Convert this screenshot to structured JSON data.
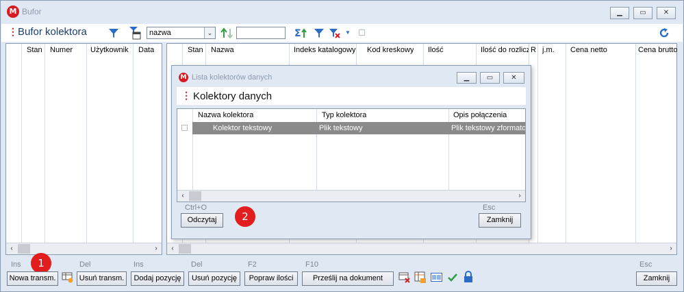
{
  "window": {
    "title": "Bufor",
    "logo": "M"
  },
  "toolbar": {
    "title": "Bufor kolektora",
    "sort_field": "nazwa",
    "search_value": ""
  },
  "left_grid": {
    "columns": [
      "Stan",
      "Numer",
      "Użytkownik",
      "Data"
    ]
  },
  "right_grid": {
    "columns": [
      "Stan",
      "Nazwa",
      "Indeks katalogowy",
      "Kod kreskowy",
      "Ilość",
      "Ilość do rozlicz",
      "R",
      "j.m.",
      "Cena netto",
      "Cena brutto"
    ]
  },
  "dialog": {
    "title": "Lista kolektorów danych",
    "logo": "M",
    "header_title": "Kolektory danych",
    "columns": [
      "Nazwa kolektora",
      "Typ kolektora",
      "Opis połączenia"
    ],
    "rows": [
      {
        "name": "Kolektor tekstowy",
        "type": "Plik tekstowy",
        "description": "Plik tekstowy zformatow"
      }
    ],
    "read_key": "Ctrl+O",
    "read_label": "Odczytaj",
    "close_key": "Esc",
    "close_label": "Zamknij",
    "badge": "2"
  },
  "status": {
    "badge": "1",
    "buttons": [
      {
        "key": "Ins",
        "label": "Nowa transm."
      },
      {
        "key": "Del",
        "label": "Usuń transm."
      },
      {
        "key": "Ins",
        "label": "Dodaj pozycję"
      },
      {
        "key": "Del",
        "label": "Usuń pozycję"
      },
      {
        "key": "F2",
        "label": "Popraw ilości"
      },
      {
        "key": "F10",
        "label": "Prześlij na dokument"
      }
    ],
    "close_key": "Esc",
    "close_label": "Zamknij"
  },
  "colors": {
    "accent": "#d81b23",
    "selected_row": "#8a8a8a",
    "badge": "#e21d1d"
  }
}
